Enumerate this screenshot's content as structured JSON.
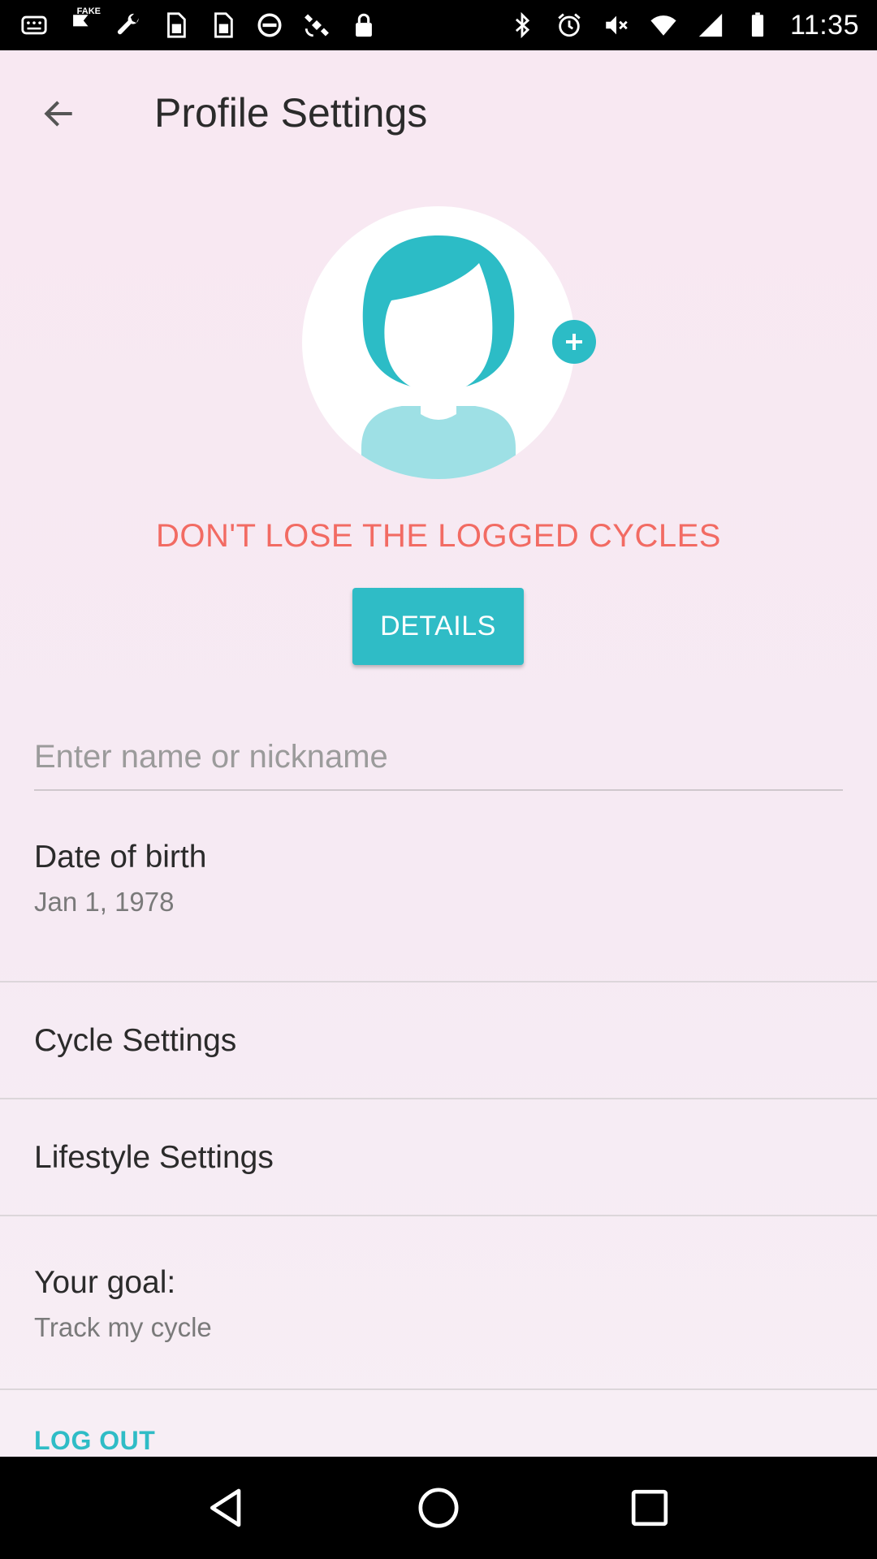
{
  "status_bar": {
    "time": "11:35",
    "left_icons": [
      "notification-icon",
      "fake-gps-icon",
      "wrench-icon",
      "sim-icon",
      "sim-icon",
      "blocked-icon",
      "satellite-icon",
      "lock-icon"
    ],
    "right_icons": [
      "bluetooth-icon",
      "alarm-icon",
      "mute-icon",
      "wifi-icon",
      "signal-icon",
      "battery-icon"
    ],
    "fake_badge": "FAKE"
  },
  "header": {
    "title": "Profile Settings"
  },
  "avatar": {
    "accent_color": "#2cbcc6",
    "light_color": "#9ee0e5"
  },
  "promo": {
    "text": "DON'T LOSE THE LOGGED CYCLES",
    "color": "#f26b63"
  },
  "details_button": {
    "label": "DETAILS",
    "color": "#2fbcc6"
  },
  "name_field": {
    "value": "",
    "placeholder": "Enter name or nickname"
  },
  "settings": {
    "date_of_birth": {
      "title": "Date of birth",
      "value": "Jan 1, 1978"
    },
    "cycle_settings": {
      "title": "Cycle Settings"
    },
    "lifestyle_settings": {
      "title": "Lifestyle Settings"
    },
    "goal": {
      "title": "Your goal:",
      "value": "Track my cycle"
    }
  },
  "logout": {
    "label": "LOG OUT"
  },
  "nav_bar": {
    "buttons": [
      "back-icon",
      "home-icon",
      "recents-icon"
    ]
  }
}
